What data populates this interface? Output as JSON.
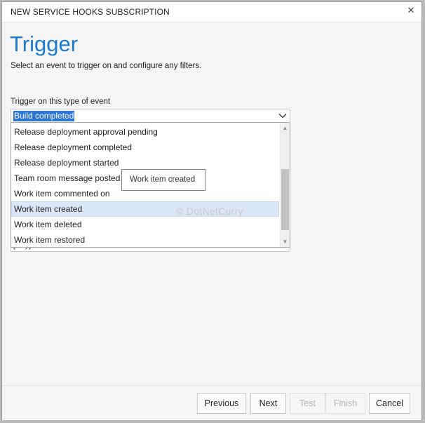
{
  "dialog": {
    "title": "NEW SERVICE HOOKS SUBSCRIPTION",
    "close_icon": "close-icon"
  },
  "page": {
    "heading": "Trigger",
    "subtitle": "Select an event to trigger on and configure any filters."
  },
  "trigger_select": {
    "label": "Trigger on this type of event",
    "selected": "Build completed",
    "chevron_icon": "chevron-down-icon"
  },
  "dropdown": {
    "options": [
      "Release deployment approval pending",
      "Release deployment completed",
      "Release deployment started",
      "Team room message posted",
      "Work item commented on",
      "Work item created",
      "Work item deleted",
      "Work item restored"
    ],
    "hovered": "Work item created"
  },
  "tooltip": {
    "text": "Work item created"
  },
  "hidden_field": {
    "value": "[Any]"
  },
  "watermark": "© DotNetCurry",
  "footer": {
    "previous": "Previous",
    "next": "Next",
    "test": "Test",
    "finish": "Finish",
    "cancel": "Cancel"
  }
}
